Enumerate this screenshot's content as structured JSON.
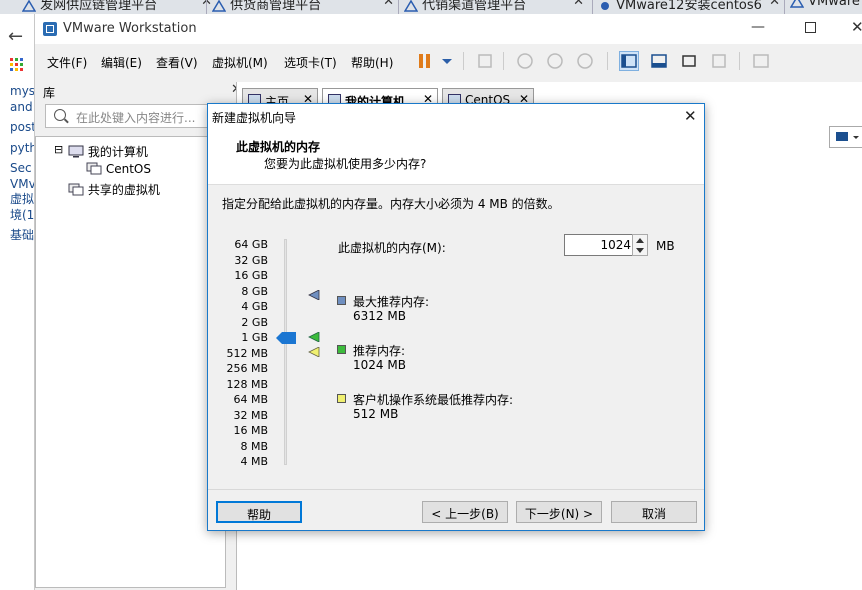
{
  "browser_tabs": [
    {
      "label": "发网供应链管理平台"
    },
    {
      "label": "供货商管理平台"
    },
    {
      "label": "代销渠道管理平台"
    },
    {
      "label": "VMware12安装centos6"
    },
    {
      "label": "VMware"
    }
  ],
  "page_side_text": [
    "mys",
    "and",
    "post",
    "pyth",
    "Sec",
    "VMv",
    "虚拟",
    "境(1",
    "基础"
  ],
  "app": {
    "title": "VMware Workstation"
  },
  "menu": [
    "文件(F)",
    "编辑(E)",
    "查看(V)",
    "虚拟机(M)",
    "选项卡(T)",
    "帮助(H)"
  ],
  "library": {
    "title": "库",
    "search_placeholder": "在此处键入内容进行...",
    "tree": [
      {
        "label": "我的计算机",
        "expander": "⊟"
      },
      {
        "label": "CentOS"
      },
      {
        "label": "共享的虚拟机"
      }
    ]
  },
  "main_tabs": [
    {
      "label": "主页"
    },
    {
      "label": "我的计算机"
    },
    {
      "label": "CentOS"
    }
  ],
  "dialog": {
    "title": "新建虚拟机向导",
    "heading": "此虚拟机的内存",
    "subheading": "您要为此虚拟机使用多少内存?",
    "description": "指定分配给此虚拟机的内存量。内存大小必须为 4 MB 的倍数。",
    "memory_label": "此虚拟机的内存(M):",
    "memory_value": "1024",
    "memory_unit": "MB",
    "scale_labels": [
      "64 GB",
      "32 GB",
      "16 GB",
      "8 GB",
      "4 GB",
      "2 GB",
      "1 GB",
      "512 MB",
      "256 MB",
      "128 MB",
      "64 MB",
      "32 MB",
      "16 MB",
      "8 MB",
      "4 MB"
    ],
    "legend": [
      {
        "label": "最大推荐内存:",
        "value": "6312 MB",
        "color": "#6f8fc0"
      },
      {
        "label": "推荐内存:",
        "value": "1024 MB",
        "color": "#3cbb3c"
      },
      {
        "label": "客户机操作系统最低推荐内存:",
        "value": "512 MB",
        "color": "#f0f070"
      }
    ],
    "buttons": {
      "help": "帮助",
      "back": "< 上一步(B)",
      "next": "下一步(N) >",
      "cancel": "取消"
    }
  }
}
